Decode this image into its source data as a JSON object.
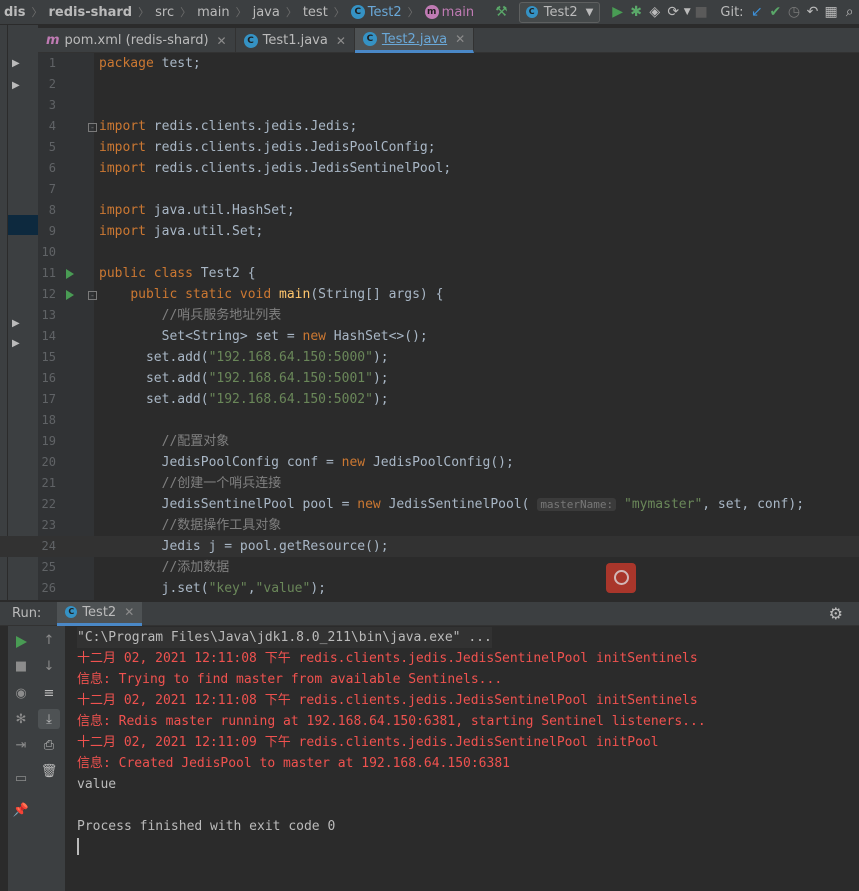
{
  "breadcrumbs": [
    "dis",
    "redis-shard",
    "src",
    "main",
    "java",
    "test",
    "Test2",
    "main"
  ],
  "toolbar": {
    "run_config": "Test2",
    "git_label": "Git:"
  },
  "tabs": [
    {
      "label": "pom.xml (redis-shard)",
      "icon": "m"
    },
    {
      "label": "Test1.java",
      "icon": "c"
    },
    {
      "label": "Test2.java",
      "icon": "c"
    }
  ],
  "editor": {
    "lines": [
      {
        "n": "1",
        "html": "<span class=\"kw\">package</span> test;"
      },
      {
        "n": "2",
        "html": ""
      },
      {
        "n": "3",
        "html": ""
      },
      {
        "n": "4",
        "html": "<span class=\"kw\">import</span> redis.clients.jedis.Jedis;"
      },
      {
        "n": "5",
        "html": "<span class=\"kw\">import</span> redis.clients.jedis.JedisPoolConfig;"
      },
      {
        "n": "6",
        "html": "<span class=\"kw\">import</span> redis.clients.jedis.JedisSentinelPool;"
      },
      {
        "n": "7",
        "html": ""
      },
      {
        "n": "8",
        "html": "<span class=\"kw\">import</span> java.util.HashSet;"
      },
      {
        "n": "9",
        "html": "<span class=\"kw\">import</span> java.util.Set;"
      },
      {
        "n": "10",
        "html": ""
      },
      {
        "n": "11",
        "html": "<span class=\"kw\">public class</span> Test2 {"
      },
      {
        "n": "12",
        "html": "    <span class=\"kw\">public static void</span> <span class=\"fn\">main</span>(String[] args) {"
      },
      {
        "n": "13",
        "html": "        <span class=\"cm\">//哨兵服务地址列表</span>"
      },
      {
        "n": "14",
        "html": "        Set&lt;String&gt; set = <span class=\"kw\">new</span> HashSet&lt;&gt;();"
      },
      {
        "n": "15",
        "html": "      set.add(<span class=\"str\">\"192.168.64.150:5000\"</span>);"
      },
      {
        "n": "16",
        "html": "      set.add(<span class=\"str\">\"192.168.64.150:5001\"</span>);"
      },
      {
        "n": "17",
        "html": "      set.add(<span class=\"str\">\"192.168.64.150:5002\"</span>);"
      },
      {
        "n": "18",
        "html": ""
      },
      {
        "n": "19",
        "html": "        <span class=\"cm\">//配置对象</span>"
      },
      {
        "n": "20",
        "html": "        JedisPoolConfig conf = <span class=\"kw\">new</span> JedisPoolConfig();"
      },
      {
        "n": "21",
        "html": "        <span class=\"cm\">//创建一个哨兵连接</span>"
      },
      {
        "n": "22",
        "html": "        JedisSentinelPool pool = <span class=\"kw\">new</span> JedisSentinelPool( <span class=\"hint\">masterName:</span> <span class=\"str\">\"mymaster\"</span>, set, conf);"
      },
      {
        "n": "23",
        "html": "        <span class=\"cm\">//数据操作工具对象</span>"
      },
      {
        "n": "24",
        "html": "        Jedis j = pool.getResource();"
      },
      {
        "n": "25",
        "html": "        <span class=\"cm\">//添加数据</span>"
      },
      {
        "n": "26",
        "html": "        j.set(<span class=\"str\">\"key\"</span>,<span class=\"str\">\"value\"</span>);"
      }
    ]
  },
  "run_panel": {
    "label": "Run:",
    "tab": "Test2",
    "console": [
      {
        "cls": "cmd",
        "text": "\"C:\\Program Files\\Java\\jdk1.8.0_211\\bin\\java.exe\" ..."
      },
      {
        "cls": "err",
        "text": "十二月 02, 2021 12:11:08 下午 redis.clients.jedis.JedisSentinelPool initSentinels"
      },
      {
        "cls": "err",
        "text": "信息: Trying to find master from available Sentinels..."
      },
      {
        "cls": "err",
        "text": "十二月 02, 2021 12:11:08 下午 redis.clients.jedis.JedisSentinelPool initSentinels"
      },
      {
        "cls": "err",
        "text": "信息: Redis master running at 192.168.64.150:6381, starting Sentinel listeners..."
      },
      {
        "cls": "err",
        "text": "十二月 02, 2021 12:11:09 下午 redis.clients.jedis.JedisSentinelPool initPool"
      },
      {
        "cls": "err",
        "text": "信息: Created JedisPool to master at 192.168.64.150:6381"
      },
      {
        "cls": "out",
        "text": "value"
      },
      {
        "cls": "out",
        "text": ""
      },
      {
        "cls": "out",
        "text": "Process finished with exit code 0"
      }
    ]
  },
  "icons": {
    "build": "hammer-icon",
    "run": "run-icon",
    "debug": "debug-icon",
    "coverage": "coverage-icon",
    "profile": "profile-icon",
    "stop": "stop-icon",
    "git_update": "git-update-icon",
    "git_commit": "git-commit-icon",
    "history": "history-icon",
    "rollback": "rollback-icon",
    "project_structure": "project-structure-icon",
    "search": "search-icon",
    "settings": "gear-icon"
  },
  "colors": {
    "editor_bg": "#2b2b2b",
    "keyword": "#cc7832",
    "string": "#6a8759",
    "comment": "#808080",
    "console_error": "#f0524f",
    "run_green": "#499c54",
    "accent_blue": "#4a88c7"
  }
}
